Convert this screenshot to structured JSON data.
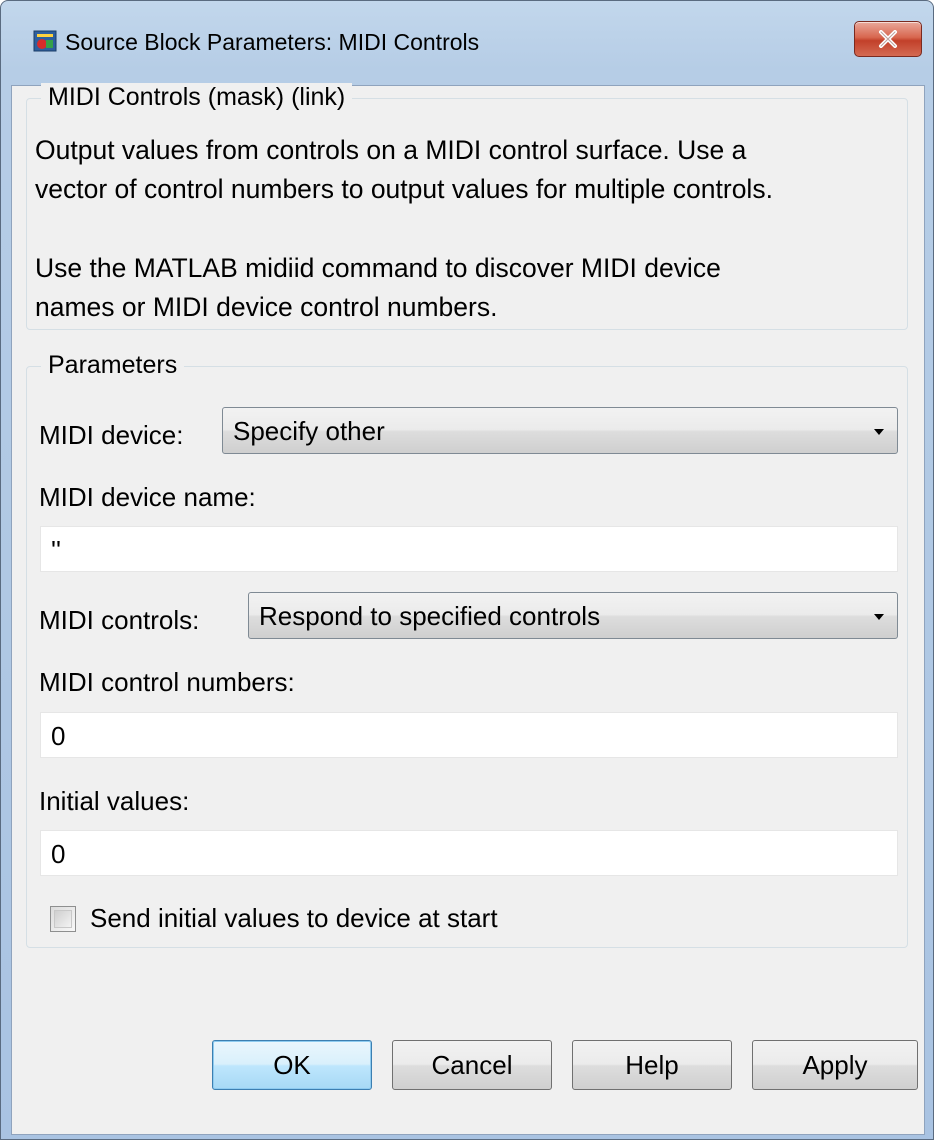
{
  "window": {
    "title": "Source Block Parameters: MIDI Controls",
    "icon": "simulink-block-icon",
    "close_icon": "close-icon"
  },
  "mask_group": {
    "legend": "MIDI Controls (mask) (link)",
    "description_line1": "Output values from controls on a MIDI control surface.  Use a",
    "description_line2": "vector of control numbers to output values for multiple controls.",
    "description_line3": "Use the MATLAB midiid command to discover MIDI device",
    "description_line4": "names or MIDI device control numbers."
  },
  "parameters_group": {
    "legend": "Parameters",
    "midi_device": {
      "label": "MIDI device:",
      "value": "Specify other"
    },
    "midi_device_name": {
      "label": "MIDI device name:",
      "value": "''"
    },
    "midi_controls": {
      "label": "MIDI controls:",
      "value": "Respond to specified controls"
    },
    "midi_control_numbers": {
      "label": "MIDI control numbers:",
      "value": "0"
    },
    "initial_values": {
      "label": "Initial values:",
      "value": "0"
    },
    "send_initial": {
      "label": "Send initial values to device at start",
      "checked": false
    }
  },
  "buttons": {
    "ok": "OK",
    "cancel": "Cancel",
    "help": "Help",
    "apply": "Apply"
  },
  "colors": {
    "title_bar": "#b6cde6",
    "close_button": "#c2402a",
    "default_button": "#bee6fd",
    "client_bg": "#f0f0f0"
  }
}
